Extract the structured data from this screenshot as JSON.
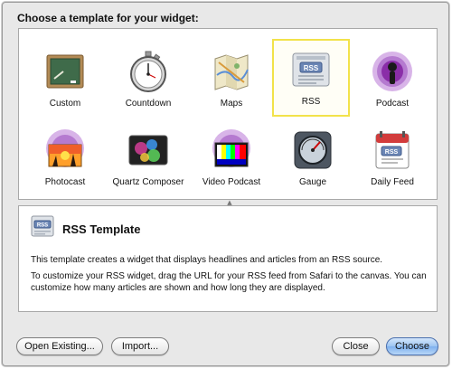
{
  "dialog": {
    "title": "Choose a template for your widget:"
  },
  "templates": [
    {
      "label": "Custom",
      "icon": "custom-chalkboard-icon"
    },
    {
      "label": "Countdown",
      "icon": "stopwatch-icon"
    },
    {
      "label": "Maps",
      "icon": "map-icon"
    },
    {
      "label": "RSS",
      "icon": "rss-icon"
    },
    {
      "label": "Podcast",
      "icon": "podcast-icon"
    },
    {
      "label": "Photocast",
      "icon": "photocast-icon"
    },
    {
      "label": "Quartz Composer",
      "icon": "quartz-composer-icon"
    },
    {
      "label": "Video Podcast",
      "icon": "video-podcast-icon"
    },
    {
      "label": "Gauge",
      "icon": "gauge-icon"
    },
    {
      "label": "Daily Feed",
      "icon": "calendar-rss-icon"
    }
  ],
  "selected_template": "RSS",
  "description": {
    "title": "RSS Template",
    "icon_text": "RSS",
    "paragraph1": "This template creates a widget that displays headlines and articles from an RSS source.",
    "paragraph2": "To customize your RSS widget, drag the URL for your RSS feed from Safari to the canvas. You can customize how many articles are shown and how long they are displayed."
  },
  "buttons": {
    "open_existing": "Open Existing...",
    "import": "Import...",
    "close": "Close",
    "choose": "Choose"
  },
  "colors": {
    "selection_border": "#f2e24a",
    "podcast_purple": "#8a2ea8",
    "primary_button": "#7fb1ee"
  }
}
